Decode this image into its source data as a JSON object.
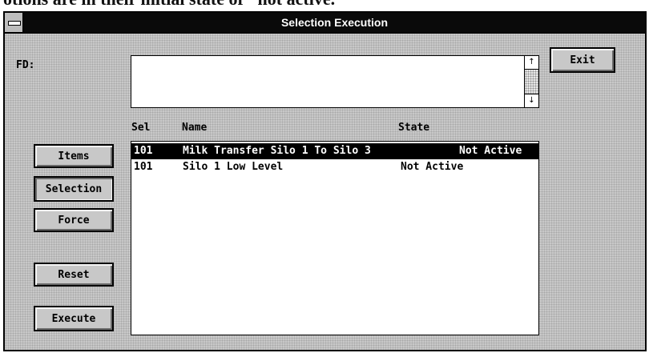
{
  "caption_text": "otions are in their initial state of \"not active.\"",
  "window": {
    "title": "Selection Execution"
  },
  "fd": {
    "label": "FD:",
    "value": ""
  },
  "buttons": {
    "exit": "Exit",
    "items": "Items",
    "selection": "Selection",
    "force": "Force",
    "reset": "Reset",
    "execute": "Execute"
  },
  "scrollbar": {
    "up_icon": "↑",
    "down_icon": "↓"
  },
  "list": {
    "headers": {
      "sel": "Sel",
      "name": "Name",
      "state": "State"
    },
    "rows": [
      {
        "sel": "101",
        "name": "Milk Transfer Silo 1 To Silo 3",
        "state": "Not Active",
        "selected": true
      },
      {
        "sel": "101",
        "name": "Silo 1 Low Level",
        "state": "Not Active",
        "selected": false
      }
    ]
  }
}
